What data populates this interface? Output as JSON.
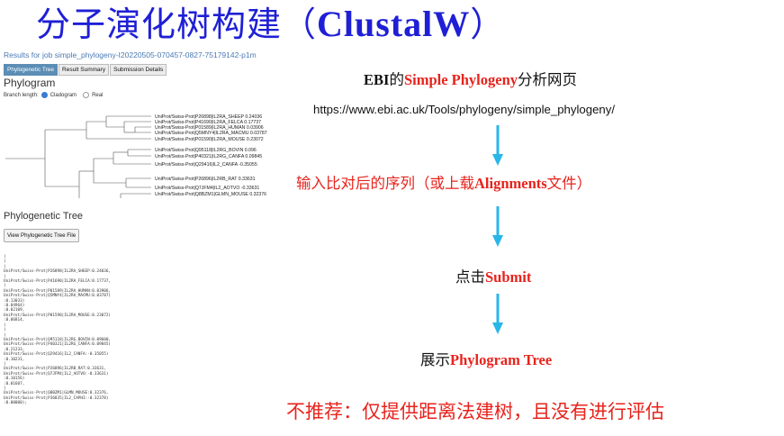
{
  "slide": {
    "title_zh": "分子演化树构建（",
    "title_en": "ClustalW",
    "title_close": "）"
  },
  "webpage": {
    "job_title": "Results for job simple_phylogeny-I20220505-070457-0827-75179142-p1m",
    "tabs": [
      {
        "label": "Phylogenetic Tree",
        "active": true
      },
      {
        "label": "Result Summary",
        "active": false
      },
      {
        "label": "Submission Details",
        "active": false
      }
    ],
    "phylogram_heading": "Phylogram",
    "branch_length_label": "Branch length:",
    "branch_options": [
      "Cladogram",
      "Real"
    ],
    "branch_selected": "Cladogram",
    "tree_leaves": [
      "UniProt/Swiss-Prot|P26898|IL2RA_SHEEP 0.24036",
      "UniProt/Swiss-Prot|P41690|IL2RA_FELCA 0.17737",
      "UniProt/Swiss-Prot|P01589|IL2RA_HUMAN 0.03906",
      "UniProt/Swiss-Prot|Q5MNY4|IL2RA_MACMU 0.03787",
      "UniProt/Swiss-Prot|P01590|IL2RA_MOUSE 0.23072",
      "UniProt/Swiss-Prot|Q95118|IL2RG_BOVIN 0.096",
      "UniProt/Swiss-Prot|P40321|IL2RG_CANFA 0.09845",
      "UniProt/Swiss-Prot|Q29416|IL2_CANFA -0.35055",
      "UniProt/Swiss-Prot|P26896|IL2RB_RAT 0.33631",
      "UniProt/Swiss-Prot|Q7JFM4|IL2_AOTVO -0.33631",
      "UniProt/Swiss-Prot|Q8BZM1|GLMN_MOUSE 0.32376",
      "UniProt/Swiss-Prot|P36835|IL2_CAPHI -0.32378"
    ],
    "phylo_tree_heading": "Phylogenetic Tree",
    "view_button": "View Phylogenetic Tree File",
    "newick_text": "(\n(\n(\nUniProt/Swiss-Prot|P26898|IL2RA_SHEEP:0.24036,\n(\nUniProt/Swiss-Prot|P41690|IL2RA_FELCA:0.17737,\n(\nUniProt/Swiss-Prot|P01589|IL2RA_HUMAN:0.03906,\nUniProt/Swiss-Prot|Q5MNY4|IL2RA_MACMU:0.03787)\n:0.13033)\n:0.04964)\n:0.02109,\nUniProt/Swiss-Prot|P01590|IL2RA_MOUSE:0.23072)\n:0.06814,\n(\n(\n(\nUniProt/Swiss-Prot|Q95118|IL2RG_BOVIN:0.09600,\nUniProt/Swiss-Prot|P40321|IL2RG_CANFA:0.09845)\n:0.21233,\nUniProt/Swiss-Prot|Q29416|IL2_CANFA:-0.35055)\n:0.10231,\n(\nUniProt/Swiss-Prot|P26896|IL2RB_RAT:0.33631,\nUniProt/Swiss-Prot|Q7JFM4|IL2_AOTVO:-0.33631)\n:0.10156)\n:0.01607,\n(\nUniProt/Swiss-Prot|Q8BZM1|GLMN_MOUSE:0.32376,\nUniProt/Swiss-Prot|P36835|IL2_CAPHI:-0.32378)\n:0.00000);"
  },
  "flow": {
    "ebi_prefix": "EBI",
    "ebi_mid": "的",
    "ebi_highlight": "Simple Phylogeny",
    "ebi_suffix": "分析网页",
    "url": "https://www.ebi.ac.uk/Tools/phylogeny/simple_phylogeny/",
    "step1_prefix": "输入比对后的序列（或上载",
    "step1_en": "Alignments",
    "step1_suffix": "文件）",
    "step2_prefix": "点击",
    "step2_en": "Submit",
    "step3_prefix": "展示",
    "step3_en": "Phylogram Tree",
    "note": "不推荐：仅提供距离法建树，且没有进行评估"
  },
  "colors": {
    "title": "#1f1fd6",
    "highlight": "#e8231c",
    "arrow": "#29b6e8",
    "tab_active": "#5b8db5"
  }
}
